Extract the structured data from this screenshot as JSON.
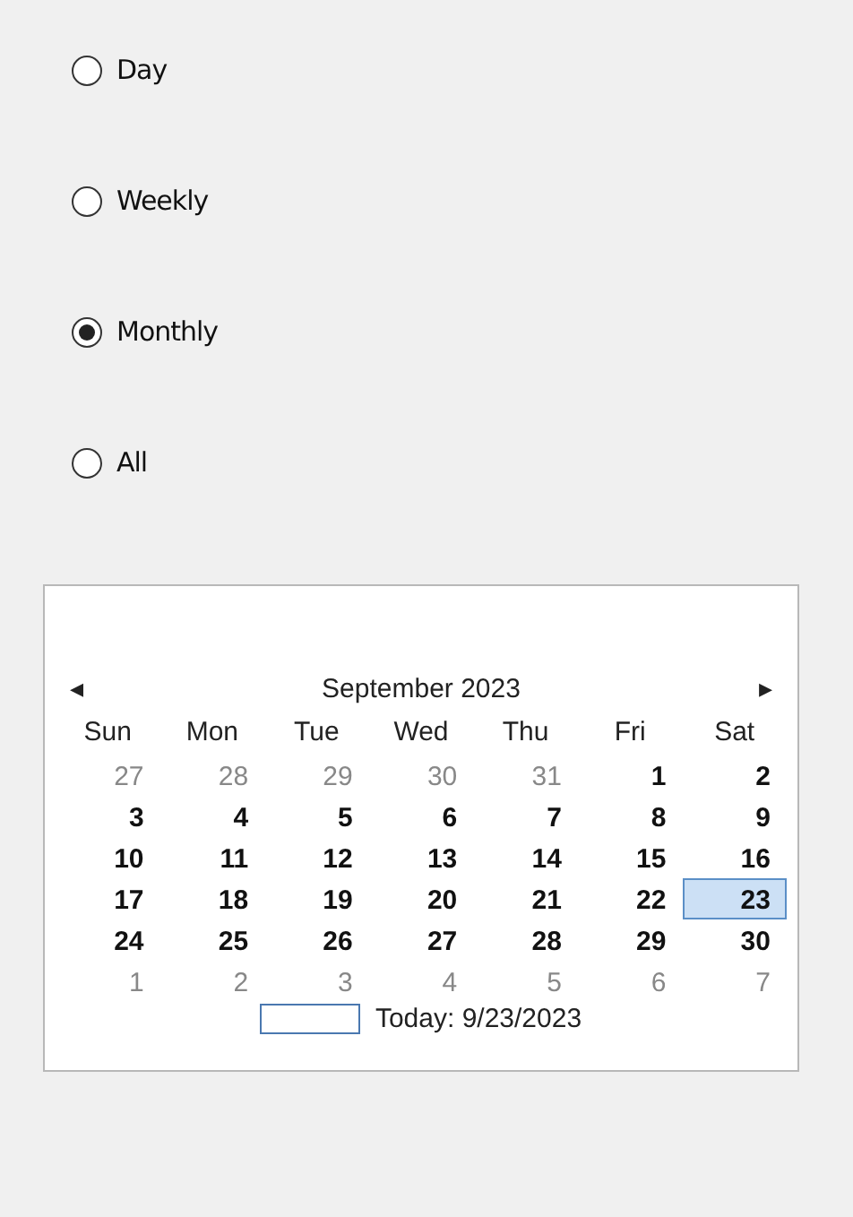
{
  "period_options": [
    {
      "label": "Day",
      "selected": false
    },
    {
      "label": "Weekly",
      "selected": false
    },
    {
      "label": "Monthly",
      "selected": true
    },
    {
      "label": "All",
      "selected": false
    }
  ],
  "calendar": {
    "prev": "◂",
    "title": "September 2023",
    "next": "▸",
    "weekdays": [
      "Sun",
      "Mon",
      "Tue",
      "Wed",
      "Thu",
      "Fri",
      "Sat"
    ],
    "weeks": [
      [
        {
          "day": "27",
          "muted": true,
          "selected": false
        },
        {
          "day": "28",
          "muted": true,
          "selected": false
        },
        {
          "day": "29",
          "muted": true,
          "selected": false
        },
        {
          "day": "30",
          "muted": true,
          "selected": false
        },
        {
          "day": "31",
          "muted": true,
          "selected": false
        },
        {
          "day": "1",
          "muted": false,
          "selected": false
        },
        {
          "day": "2",
          "muted": false,
          "selected": false
        }
      ],
      [
        {
          "day": "3",
          "muted": false,
          "selected": false
        },
        {
          "day": "4",
          "muted": false,
          "selected": false
        },
        {
          "day": "5",
          "muted": false,
          "selected": false
        },
        {
          "day": "6",
          "muted": false,
          "selected": false
        },
        {
          "day": "7",
          "muted": false,
          "selected": false
        },
        {
          "day": "8",
          "muted": false,
          "selected": false
        },
        {
          "day": "9",
          "muted": false,
          "selected": false
        }
      ],
      [
        {
          "day": "10",
          "muted": false,
          "selected": false
        },
        {
          "day": "11",
          "muted": false,
          "selected": false
        },
        {
          "day": "12",
          "muted": false,
          "selected": false
        },
        {
          "day": "13",
          "muted": false,
          "selected": false
        },
        {
          "day": "14",
          "muted": false,
          "selected": false
        },
        {
          "day": "15",
          "muted": false,
          "selected": false
        },
        {
          "day": "16",
          "muted": false,
          "selected": false
        }
      ],
      [
        {
          "day": "17",
          "muted": false,
          "selected": false
        },
        {
          "day": "18",
          "muted": false,
          "selected": false
        },
        {
          "day": "19",
          "muted": false,
          "selected": false
        },
        {
          "day": "20",
          "muted": false,
          "selected": false
        },
        {
          "day": "21",
          "muted": false,
          "selected": false
        },
        {
          "day": "22",
          "muted": false,
          "selected": false
        },
        {
          "day": "23",
          "muted": false,
          "selected": true
        }
      ],
      [
        {
          "day": "24",
          "muted": false,
          "selected": false
        },
        {
          "day": "25",
          "muted": false,
          "selected": false
        },
        {
          "day": "26",
          "muted": false,
          "selected": false
        },
        {
          "day": "27",
          "muted": false,
          "selected": false
        },
        {
          "day": "28",
          "muted": false,
          "selected": false
        },
        {
          "day": "29",
          "muted": false,
          "selected": false
        },
        {
          "day": "30",
          "muted": false,
          "selected": false
        }
      ],
      [
        {
          "day": "1",
          "muted": true,
          "selected": false
        },
        {
          "day": "2",
          "muted": true,
          "selected": false
        },
        {
          "day": "3",
          "muted": true,
          "selected": false
        },
        {
          "day": "4",
          "muted": true,
          "selected": false
        },
        {
          "day": "5",
          "muted": true,
          "selected": false
        },
        {
          "day": "6",
          "muted": true,
          "selected": false
        },
        {
          "day": "7",
          "muted": true,
          "selected": false
        }
      ]
    ],
    "today": "Today: 9/23/2023"
  }
}
